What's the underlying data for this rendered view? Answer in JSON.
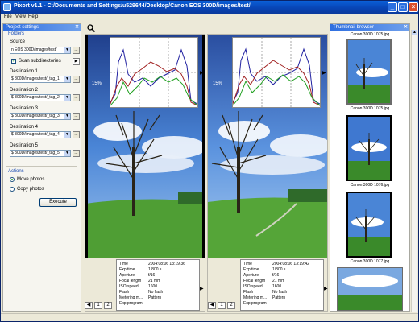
{
  "window": {
    "title": "Pixort v1.1 - C:/Documents and Settings/u529644/Desktop/Canon EOS 300D/images/test/",
    "buttons": [
      "_",
      "□",
      "×"
    ]
  },
  "menu": [
    "File",
    "View",
    "Help"
  ],
  "left_panel": {
    "header": "Project settings",
    "folders_label": "Folders",
    "source_label": "Source",
    "source_value": "n EOS 300D/images/test/",
    "scan_subdirs_label": "Scan subdirectories",
    "scan_subdirs_checked": true,
    "destinations": [
      {
        "label": "Destination 1",
        "value": "$ 300D/images/test/_tag_1"
      },
      {
        "label": "Destination 2",
        "value": "$ 300D/images/test/_tag_2"
      },
      {
        "label": "Destination 3",
        "value": "$ 300D/images/test/_tag_3"
      },
      {
        "label": "Destination 4",
        "value": "$ 300D/images/test/_tag_4"
      },
      {
        "label": "Destination 5",
        "value": "$ 300D/images/test/_tag_5"
      }
    ],
    "browse_label": "...",
    "actions_label": "Actions",
    "move_label": "Move photos",
    "copy_label": "Copy photos",
    "selected_action": "move",
    "execute_label": "Execute"
  },
  "viewers": [
    {
      "exif": [
        {
          "k": "Time",
          "v": "2004:08:06 13:19:36"
        },
        {
          "k": "Exp time",
          "v": "1/800 s"
        },
        {
          "k": "Aperture",
          "v": "f/16"
        },
        {
          "k": "Focal length",
          "v": "21 mm"
        },
        {
          "k": "ISO speed",
          "v": "1600"
        },
        {
          "k": "Flash",
          "v": "No flash"
        },
        {
          "k": "Metering m...",
          "v": "Pattern"
        },
        {
          "k": "Exp program",
          "v": ""
        }
      ],
      "pages": [
        "1",
        "2"
      ],
      "zoom": "15%"
    },
    {
      "exif": [
        {
          "k": "Time",
          "v": "2004:08:06 13:19:42"
        },
        {
          "k": "Exp time",
          "v": "1/800 s"
        },
        {
          "k": "Aperture",
          "v": "f/16"
        },
        {
          "k": "Focal length",
          "v": "21 mm"
        },
        {
          "k": "ISO speed",
          "v": "1600"
        },
        {
          "k": "Flash",
          "v": "No flash"
        },
        {
          "k": "Metering m...",
          "v": "Pattern"
        },
        {
          "k": "Exp program",
          "v": ""
        }
      ],
      "pages": [
        "1",
        "2"
      ],
      "zoom": "15%"
    }
  ],
  "thumb_panel": {
    "header": "Thumbnail browser",
    "items": [
      {
        "caption": "Canon 300D 1075.jpg"
      },
      {
        "caption": "Canon 300D 1076.jpg"
      },
      {
        "caption": "Canon 300D 1077.jpg"
      },
      {
        "caption": "Canon 300D 1078.jpg"
      }
    ],
    "top_caption": "Canon 300D 1075.jpg"
  },
  "colors": {
    "title_bar": "#0843b3",
    "panel_header": "#2f6fe0",
    "sky": "#3f78d0",
    "grass": "#3a8a2a"
  },
  "icons": [
    "search-icon",
    "histogram-icon"
  ]
}
